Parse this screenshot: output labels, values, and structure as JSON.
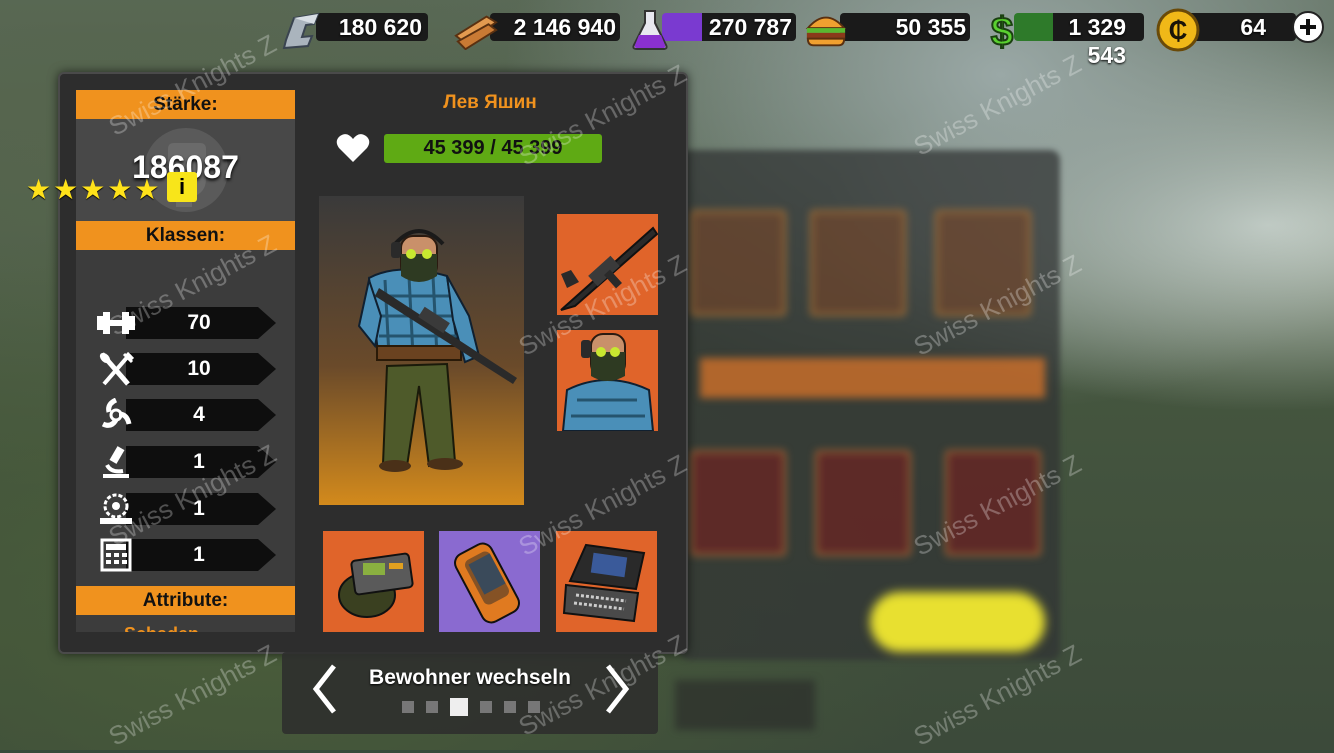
{
  "resources": [
    {
      "name": "iron",
      "value": "180 620",
      "icon": "iron-ingot-icon"
    },
    {
      "name": "wood",
      "value": "2 146 940",
      "icon": "wood-planks-icon"
    },
    {
      "name": "chemicals",
      "value": "270 787",
      "icon": "flask-icon"
    },
    {
      "name": "food",
      "value": "50 355",
      "icon": "burger-icon"
    },
    {
      "name": "money",
      "value": "1 329 543",
      "icon": "dollar-icon"
    },
    {
      "name": "caps",
      "value": "64",
      "icon": "coin-icon"
    }
  ],
  "side": {
    "strength_label": "Stärke:",
    "strength_value": "186087",
    "classes_label": "Klassen:",
    "stars": "★★★★★",
    "info": "i",
    "stats": [
      {
        "icon": "dumbbell-icon",
        "value": "70"
      },
      {
        "icon": "fork-spoon-icon",
        "value": "10"
      },
      {
        "icon": "biohazard-icon",
        "value": "4"
      },
      {
        "icon": "microscope-icon",
        "value": "1"
      },
      {
        "icon": "saw-blade-icon",
        "value": "1"
      },
      {
        "icon": "calculator-icon",
        "value": "1"
      }
    ],
    "attributes_label": "Attribute:",
    "cut_text": "Schaden"
  },
  "character": {
    "name": "Лев Яшин",
    "hp": "45 399 / 45 399"
  },
  "nav": {
    "label": "Bewohner wechseln",
    "page_count": 6,
    "active_page": 3
  },
  "watermark": "Swiss Knights Z",
  "colors": {
    "accent": "#f0921e",
    "hp": "#5faa14",
    "slot": "#e0642a",
    "slot_alt": "#8a6ad0"
  }
}
